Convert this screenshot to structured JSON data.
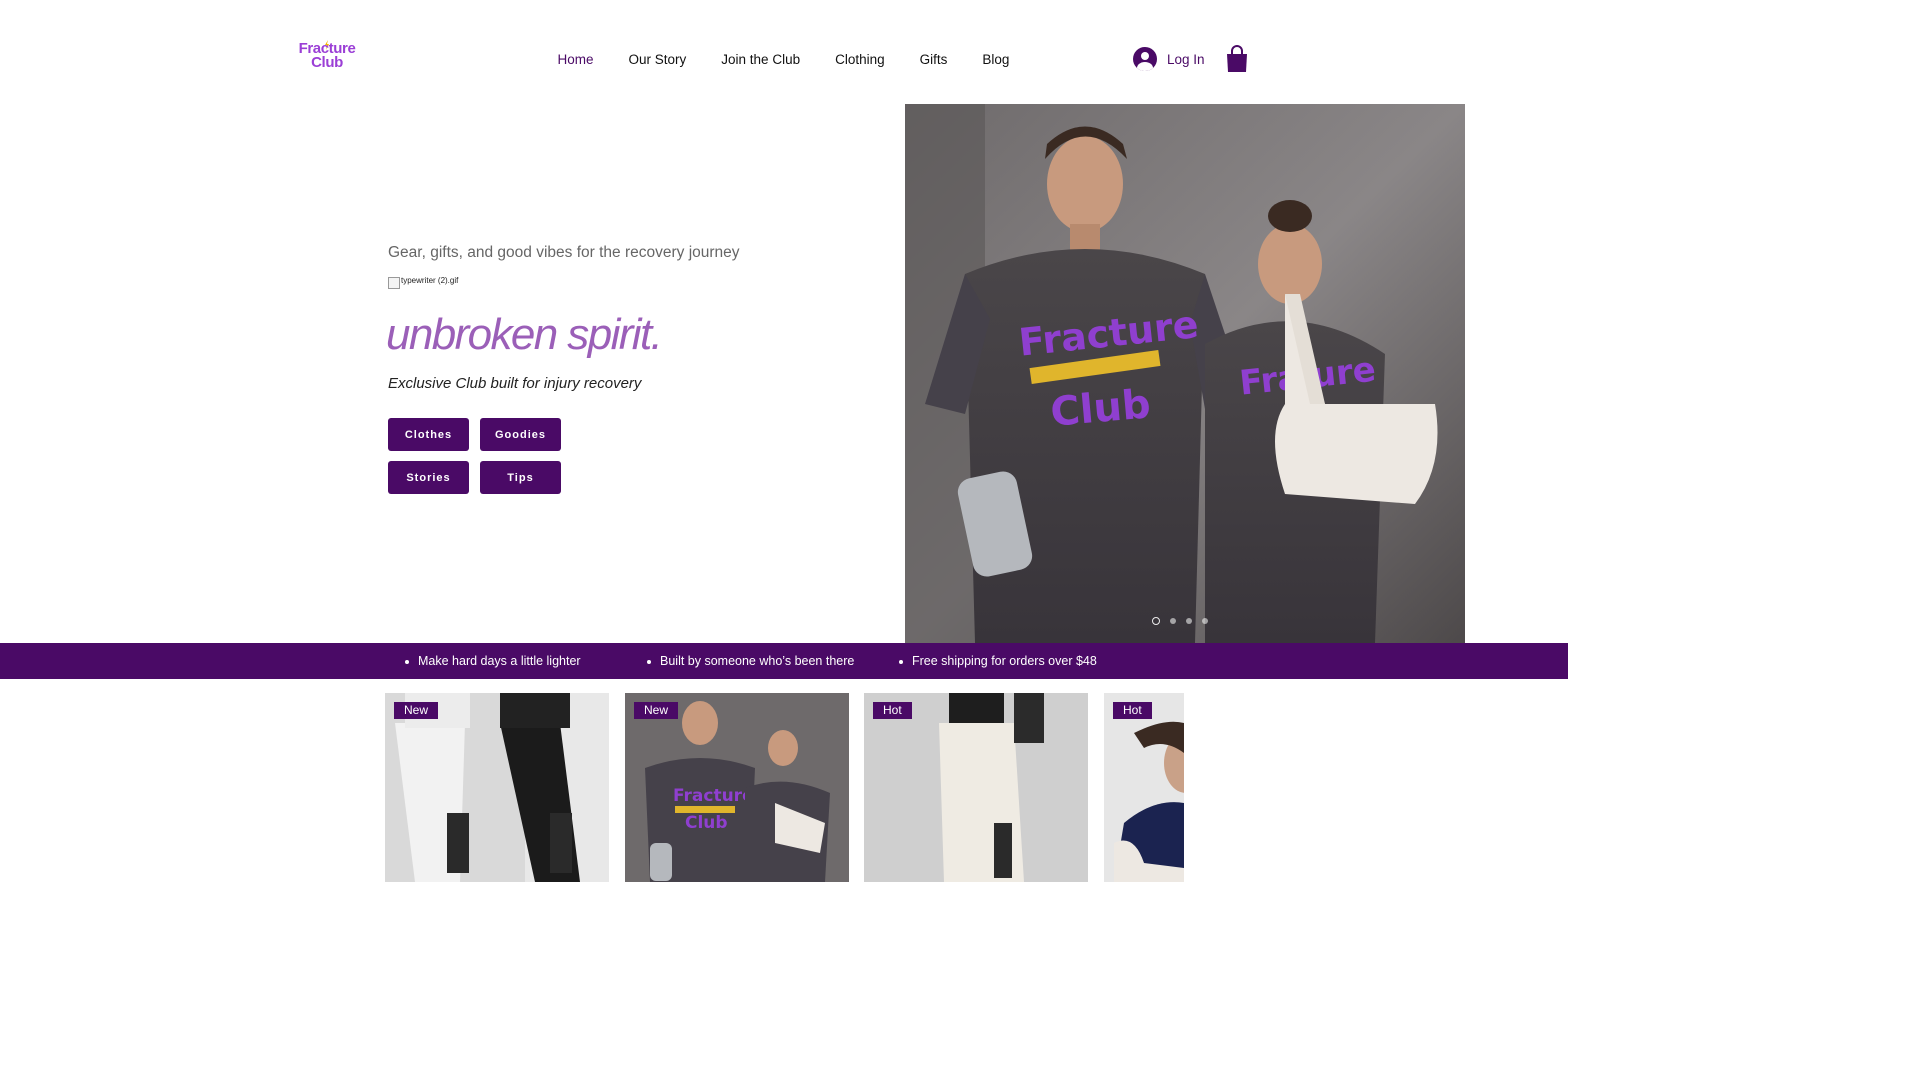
{
  "brand": {
    "logo_line1": "Fracture",
    "logo_line2": "Club",
    "accent": "#4a0a66",
    "logo_color": "#9b3fd6"
  },
  "nav": {
    "items": [
      {
        "label": "Home",
        "active": true
      },
      {
        "label": "Our Story"
      },
      {
        "label": "Join the Club"
      },
      {
        "label": "Clothing"
      },
      {
        "label": "Gifts"
      },
      {
        "label": "Blog"
      }
    ],
    "login_label": "Log In",
    "avatar_icon": "account-icon",
    "cart_icon": "shopping-bag-icon"
  },
  "hero": {
    "tagline": "Gear, gifts, and good vibes for the recovery journey",
    "gif_alt": "typewriter (2).gif",
    "title": "unbroken spirit.",
    "subtitle": "Exclusive Club built for injury recovery",
    "buttons": [
      "Clothes",
      "Goodies",
      "Stories",
      "Tips"
    ],
    "image_alt": "Two models wearing Fracture Club t-shirts with cast and arm sling",
    "image_shirt_text_1": "Fracture",
    "image_shirt_text_2": "Club",
    "slides": 4,
    "active_slide": 1
  },
  "banner": {
    "items": [
      "Make hard days a little lighter",
      "Built by someone who’s been there",
      "Free shipping for orders over $48"
    ]
  },
  "products": [
    {
      "badge": "New",
      "image": "adaptive-side-zip-pants"
    },
    {
      "badge": "New",
      "image": "fracture-club-tees"
    },
    {
      "badge": "Hot",
      "image": "cream-adaptive-pants"
    },
    {
      "badge": "Hot",
      "image": "navy-tee-sling"
    }
  ]
}
